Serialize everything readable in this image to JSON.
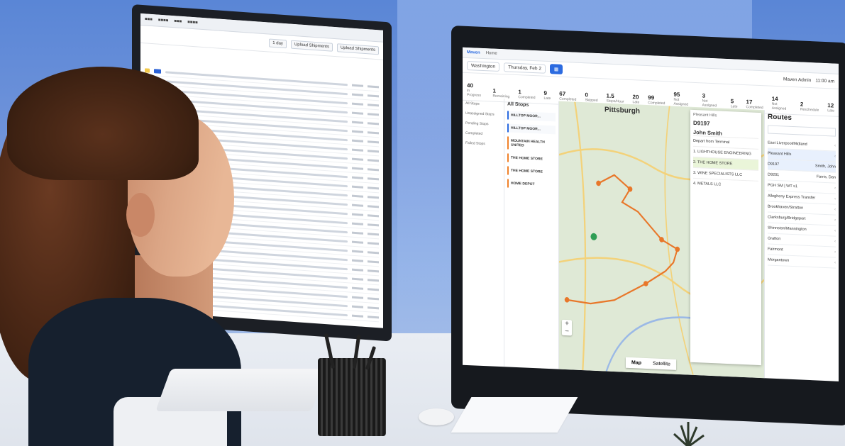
{
  "left_screen": {
    "toolbar_buttons": [
      "1 day",
      "Upload Shipments",
      "Upload Shipments"
    ]
  },
  "right_screen": {
    "app_name": "Maven",
    "app_tab": "Home",
    "region": "Washington",
    "date": "Thursday, Feb 2",
    "user": "Maven Admin",
    "time": "11:00 am",
    "stats": [
      {
        "value": "40",
        "label": "In Progress"
      },
      {
        "value": "1",
        "label": "Remaining"
      },
      {
        "value": "1",
        "label": "Completed"
      },
      {
        "value": "9",
        "label": "Late"
      },
      {
        "value": "67",
        "label": "Completed"
      },
      {
        "value": "0",
        "label": "Skipped"
      },
      {
        "value": "1.5",
        "label": "Stops/Hour"
      },
      {
        "value": "20",
        "label": "Late"
      },
      {
        "value": "99",
        "label": "Completed"
      },
      {
        "value": "95",
        "label": "Not Assigned"
      },
      {
        "value": "3",
        "label": "Not Assigned"
      },
      {
        "value": "5",
        "label": "Late"
      },
      {
        "value": "17",
        "label": "Completed"
      },
      {
        "value": "14",
        "label": "Not Assigned"
      },
      {
        "value": "2",
        "label": "Reschedule"
      },
      {
        "value": "12",
        "label": "Late"
      }
    ],
    "nav": [
      "All Stops",
      "Unassigned Stops",
      "Pending Stops",
      "Completed",
      "Failed Stops"
    ],
    "stops_title": "All Stops",
    "stop_cards": [
      {
        "name": "HILLTOP MOOR...",
        "color": "blue"
      },
      {
        "name": "HILLTOP MOOR...",
        "color": "blue"
      },
      {
        "name": "MOUNTAIN HEALTH UNITED",
        "color": "orange"
      },
      {
        "name": "THE HOME STORE",
        "color": "orange"
      },
      {
        "name": "THE HOME STORE",
        "color": "orange"
      },
      {
        "name": "HOME DEPOT",
        "color": "orange"
      }
    ],
    "map": {
      "city": "Pittsburgh",
      "toggle": [
        "Map",
        "Satellite"
      ]
    },
    "stop_panel": {
      "title": "Pleasant Hills",
      "code": "D9197",
      "driver": "John Smith",
      "items": [
        "Depart from Terminal",
        "1. LIGHTHOUSE ENGINEERING",
        "2. THE HOME STORE",
        "3. WINE SPECIALISTS LLC",
        "4. METALS LLC"
      ]
    },
    "routes": {
      "title": "Routes",
      "items": [
        {
          "name": "East Liverpool/Midland",
          "right": ""
        },
        {
          "name": "Pleasant Hills",
          "right": ""
        },
        {
          "name": "D9197",
          "right": "Smith, John"
        },
        {
          "name": "D9201",
          "right": "Farris, Dan"
        },
        {
          "name": "PGH SM | WT s1",
          "right": ""
        },
        {
          "name": "Allegheny Express Transfer",
          "right": ""
        },
        {
          "name": "Brookhaven/Stratton",
          "right": ""
        },
        {
          "name": "Clarksburg/Bridgeport",
          "right": ""
        },
        {
          "name": "Shinnston/Mannington",
          "right": ""
        },
        {
          "name": "Grafton",
          "right": ""
        },
        {
          "name": "Fairmont",
          "right": ""
        },
        {
          "name": "Morgantown",
          "right": ""
        }
      ]
    }
  },
  "colors": {
    "brand_blue": "#2c6be0",
    "route_orange": "#e8772a",
    "map_green": "#dfe9d6"
  }
}
